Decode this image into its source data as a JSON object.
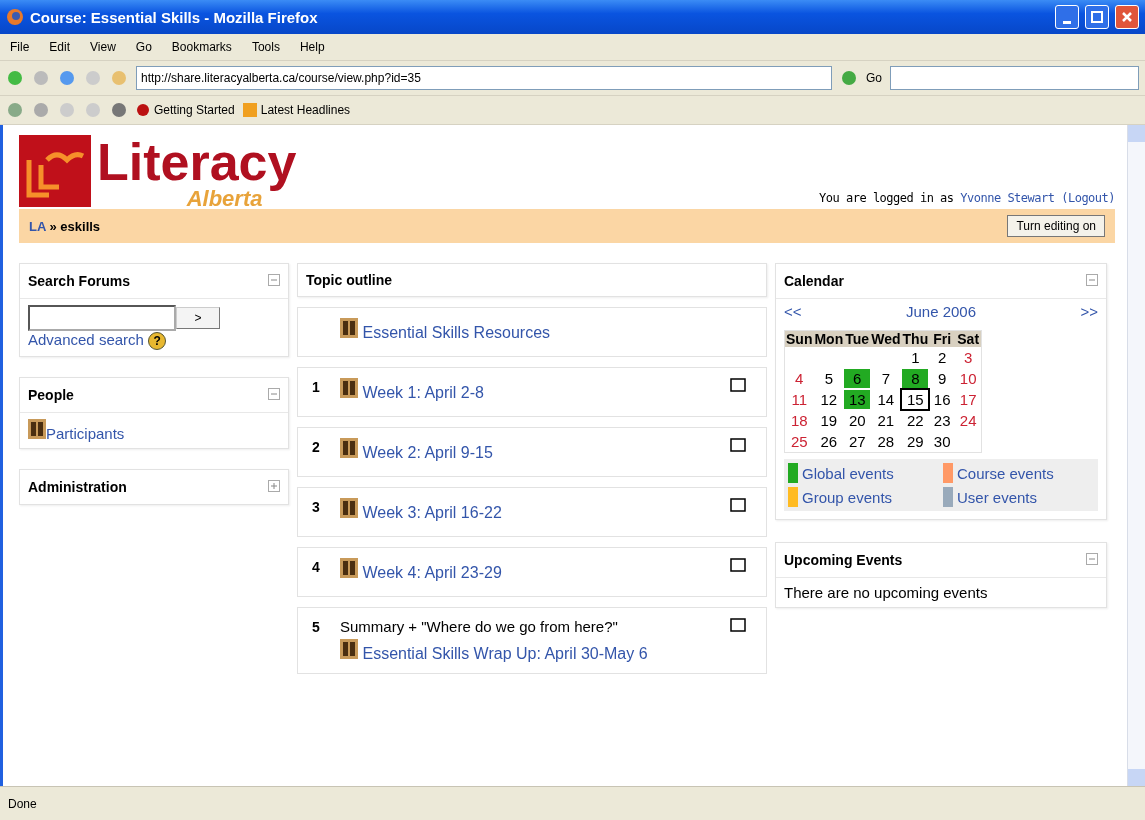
{
  "window": {
    "title": "Course: Essential Skills - Mozilla Firefox"
  },
  "menu": [
    "File",
    "Edit",
    "View",
    "Go",
    "Bookmarks",
    "Tools",
    "Help"
  ],
  "address": {
    "value": "http://share.literacyalberta.ca/course/view.php?id=35",
    "go": "Go"
  },
  "bookmarks": [
    "Getting Started",
    "Latest Headlines"
  ],
  "logo": {
    "name": "Literacy",
    "region": "Alberta"
  },
  "login": {
    "prefix": "You are logged in as",
    "user": "Yvonne Stewart",
    "logout": "(Logout)"
  },
  "breadcrumb": {
    "home": "LA",
    "separator": "»",
    "current": "eskills"
  },
  "edit_button": "Turn editing on",
  "left_blocks": [
    {
      "kind": "search",
      "title": "Search Forums",
      "collapsed": false,
      "go": ">",
      "link": "Advanced search",
      "help": "?"
    },
    {
      "kind": "people",
      "title": "People",
      "collapsed": false,
      "link": "Participants"
    },
    {
      "kind": "admin",
      "title": "Administration",
      "collapsed": true
    }
  ],
  "outline": {
    "title": "Topic outline",
    "sections": [
      {
        "link": "Essential Skills Resources"
      },
      {
        "number": "1",
        "link": "Week 1: April 2-8"
      },
      {
        "number": "2",
        "link": "Week 2: April 9-15"
      },
      {
        "number": "3",
        "link": "Week 3: April 16-22"
      },
      {
        "number": "4",
        "link": "Week 4: April 23-29"
      },
      {
        "number": "5",
        "summary": "Summary + \"Where do we go from here?\"",
        "link": "Essential Skills Wrap Up: April 30-May 6"
      }
    ]
  },
  "calendar": {
    "title": "Calendar",
    "collapsed": false,
    "prev": "<<",
    "month": "June 2006",
    "next": ">>",
    "weekdays": [
      "Sun",
      "Mon",
      "Tue",
      "Wed",
      "Thu",
      "Fri",
      "Sat"
    ],
    "weeks": [
      {
        "right_aligned": true,
        "days": [
          {
            "day": "1",
            "weekend": false,
            "event": false,
            "today": false
          },
          {
            "day": "2",
            "weekend": false,
            "event": false,
            "today": false
          },
          {
            "day": "3",
            "weekend": true,
            "event": false,
            "today": false
          }
        ]
      },
      {
        "days": [
          {
            "day": "4",
            "weekend": true,
            "event": false,
            "today": false
          },
          {
            "day": "5",
            "weekend": false,
            "event": false,
            "today": false
          },
          {
            "day": "6",
            "weekend": false,
            "event": true,
            "today": false
          },
          {
            "day": "7",
            "weekend": false,
            "event": false,
            "today": false
          },
          {
            "day": "8",
            "weekend": false,
            "event": true,
            "today": false
          },
          {
            "day": "9",
            "weekend": false,
            "event": false,
            "today": false
          },
          {
            "day": "10",
            "weekend": true,
            "event": false,
            "today": false
          }
        ]
      },
      {
        "days": [
          {
            "day": "11",
            "weekend": true,
            "event": false,
            "today": false
          },
          {
            "day": "12",
            "weekend": false,
            "event": false,
            "today": false
          },
          {
            "day": "13",
            "weekend": false,
            "event": true,
            "today": false
          },
          {
            "day": "14",
            "weekend": false,
            "event": false,
            "today": false
          },
          {
            "day": "15",
            "weekend": false,
            "event": false,
            "today": true
          },
          {
            "day": "16",
            "weekend": false,
            "event": false,
            "today": false
          },
          {
            "day": "17",
            "weekend": true,
            "event": false,
            "today": false
          }
        ]
      },
      {
        "days": [
          {
            "day": "18",
            "weekend": true,
            "event": false,
            "today": false
          },
          {
            "day": "19",
            "weekend": false,
            "event": false,
            "today": false
          },
          {
            "day": "20",
            "weekend": false,
            "event": false,
            "today": false
          },
          {
            "day": "21",
            "weekend": false,
            "event": false,
            "today": false
          },
          {
            "day": "22",
            "weekend": false,
            "event": false,
            "today": false
          },
          {
            "day": "23",
            "weekend": false,
            "event": false,
            "today": false
          },
          {
            "day": "24",
            "weekend": true,
            "event": false,
            "today": false
          }
        ]
      },
      {
        "days": [
          {
            "day": "25",
            "weekend": true,
            "event": false,
            "today": false
          },
          {
            "day": "26",
            "weekend": false,
            "event": false,
            "today": false
          },
          {
            "day": "27",
            "weekend": false,
            "event": false,
            "today": false
          },
          {
            "day": "28",
            "weekend": false,
            "event": false,
            "today": false
          },
          {
            "day": "29",
            "weekend": false,
            "event": false,
            "today": false
          },
          {
            "day": "30",
            "weekend": false,
            "event": false,
            "today": false
          }
        ]
      }
    ],
    "legend": [
      {
        "label": "Global events",
        "color": "#22aa22"
      },
      {
        "label": "Course events",
        "color": "#ff9966"
      },
      {
        "label": "Group events",
        "color": "#ffbb22"
      },
      {
        "label": "User events",
        "color": "#99aabb"
      }
    ]
  },
  "upcoming": {
    "title": "Upcoming Events",
    "collapsed": false,
    "text": "There are no upcoming events"
  },
  "status_bar": "Done"
}
